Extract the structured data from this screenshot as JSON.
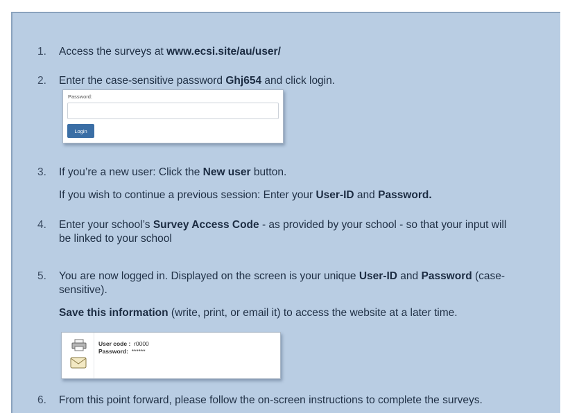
{
  "steps": [
    {
      "num": "1.",
      "before": "Access the surveys at ",
      "bold": "www.ecsi.site/au/user/",
      "after": ""
    },
    {
      "num": "2.",
      "before": "Enter the case-sensitive password ",
      "bold": "Ghj654",
      "after": " and click login."
    },
    {
      "num": "3.",
      "line1_before": "If you’re a new user: Click the ",
      "line1_bold": "New user",
      "line1_after": " button.",
      "line2_before": "If you wish to continue a previous session: Enter your ",
      "line2_bold1": "User-ID",
      "line2_mid": " and ",
      "line2_bold2": "Password."
    },
    {
      "num": "4.",
      "before": "Enter your school’s ",
      "bold": "Survey Access Code",
      "after": " - as provided by your school - so that your input will",
      "line2": "be linked to your school"
    },
    {
      "num": "5.",
      "before": "You are now logged in. Displayed on the screen is your unique ",
      "bold1": "User-ID",
      "mid": " and ",
      "bold2": "Password",
      "after": " (case-",
      "line2": "sensitive).",
      "save_bold": "Save this information",
      "save_after": " (write, print, or email it) to access the website at a later time."
    },
    {
      "num": "6.",
      "text": "From this point forward, please follow the on-screen instructions to complete the surveys."
    }
  ],
  "login_card": {
    "label": "Password:",
    "button": "Login",
    "input_value": ""
  },
  "cred_card": {
    "user_label": "User code :",
    "user_value": "r0000",
    "pw_label": "Password:",
    "pw_value": "******"
  }
}
